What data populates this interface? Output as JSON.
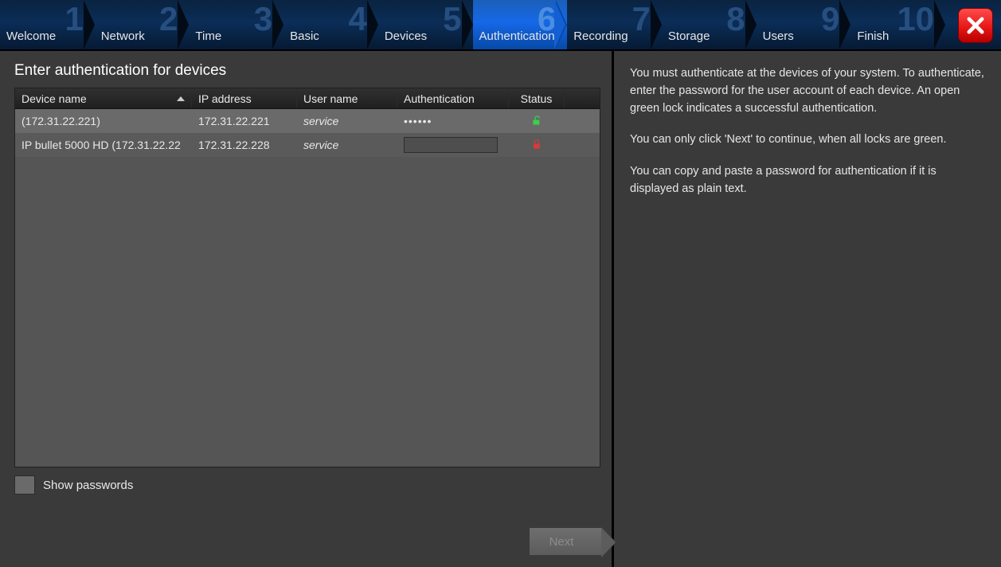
{
  "steps": [
    {
      "num": "1",
      "label": "Welcome"
    },
    {
      "num": "2",
      "label": "Network"
    },
    {
      "num": "3",
      "label": "Time"
    },
    {
      "num": "4",
      "label": "Basic"
    },
    {
      "num": "5",
      "label": "Devices"
    },
    {
      "num": "6",
      "label": "Authentication",
      "active": true
    },
    {
      "num": "7",
      "label": "Recording"
    },
    {
      "num": "8",
      "label": "Storage"
    },
    {
      "num": "9",
      "label": "Users"
    },
    {
      "num": "10",
      "label": "Finish"
    }
  ],
  "page_title": "Enter authentication for devices",
  "columns": {
    "name": "Device name",
    "ip": "IP address",
    "user": "User name",
    "auth": "Authentication",
    "status": "Status"
  },
  "rows": [
    {
      "name": " (172.31.22.221)",
      "ip": "172.31.22.221",
      "user": "service",
      "auth_display": "••••••",
      "lock": "open"
    },
    {
      "name": "IP bullet 5000 HD (172.31.22.22",
      "ip": "172.31.22.228",
      "user": "service",
      "auth_display": "",
      "lock": "closed"
    }
  ],
  "show_passwords_label": "Show passwords",
  "next_label": "Next",
  "help": {
    "p1": "You must authenticate at the devices of your system. To authenticate, enter the password for the user account of each device. An open green lock indicates a successful authentication.",
    "p2": "You can only click 'Next' to continue, when all locks are green.",
    "p3": "You can copy and paste a password for authentication if it is displayed as plain text."
  },
  "icons": {
    "close": "close-icon",
    "lock_open": "lock-open-icon",
    "lock_closed": "lock-closed-icon",
    "sort": "sort-asc-icon"
  }
}
